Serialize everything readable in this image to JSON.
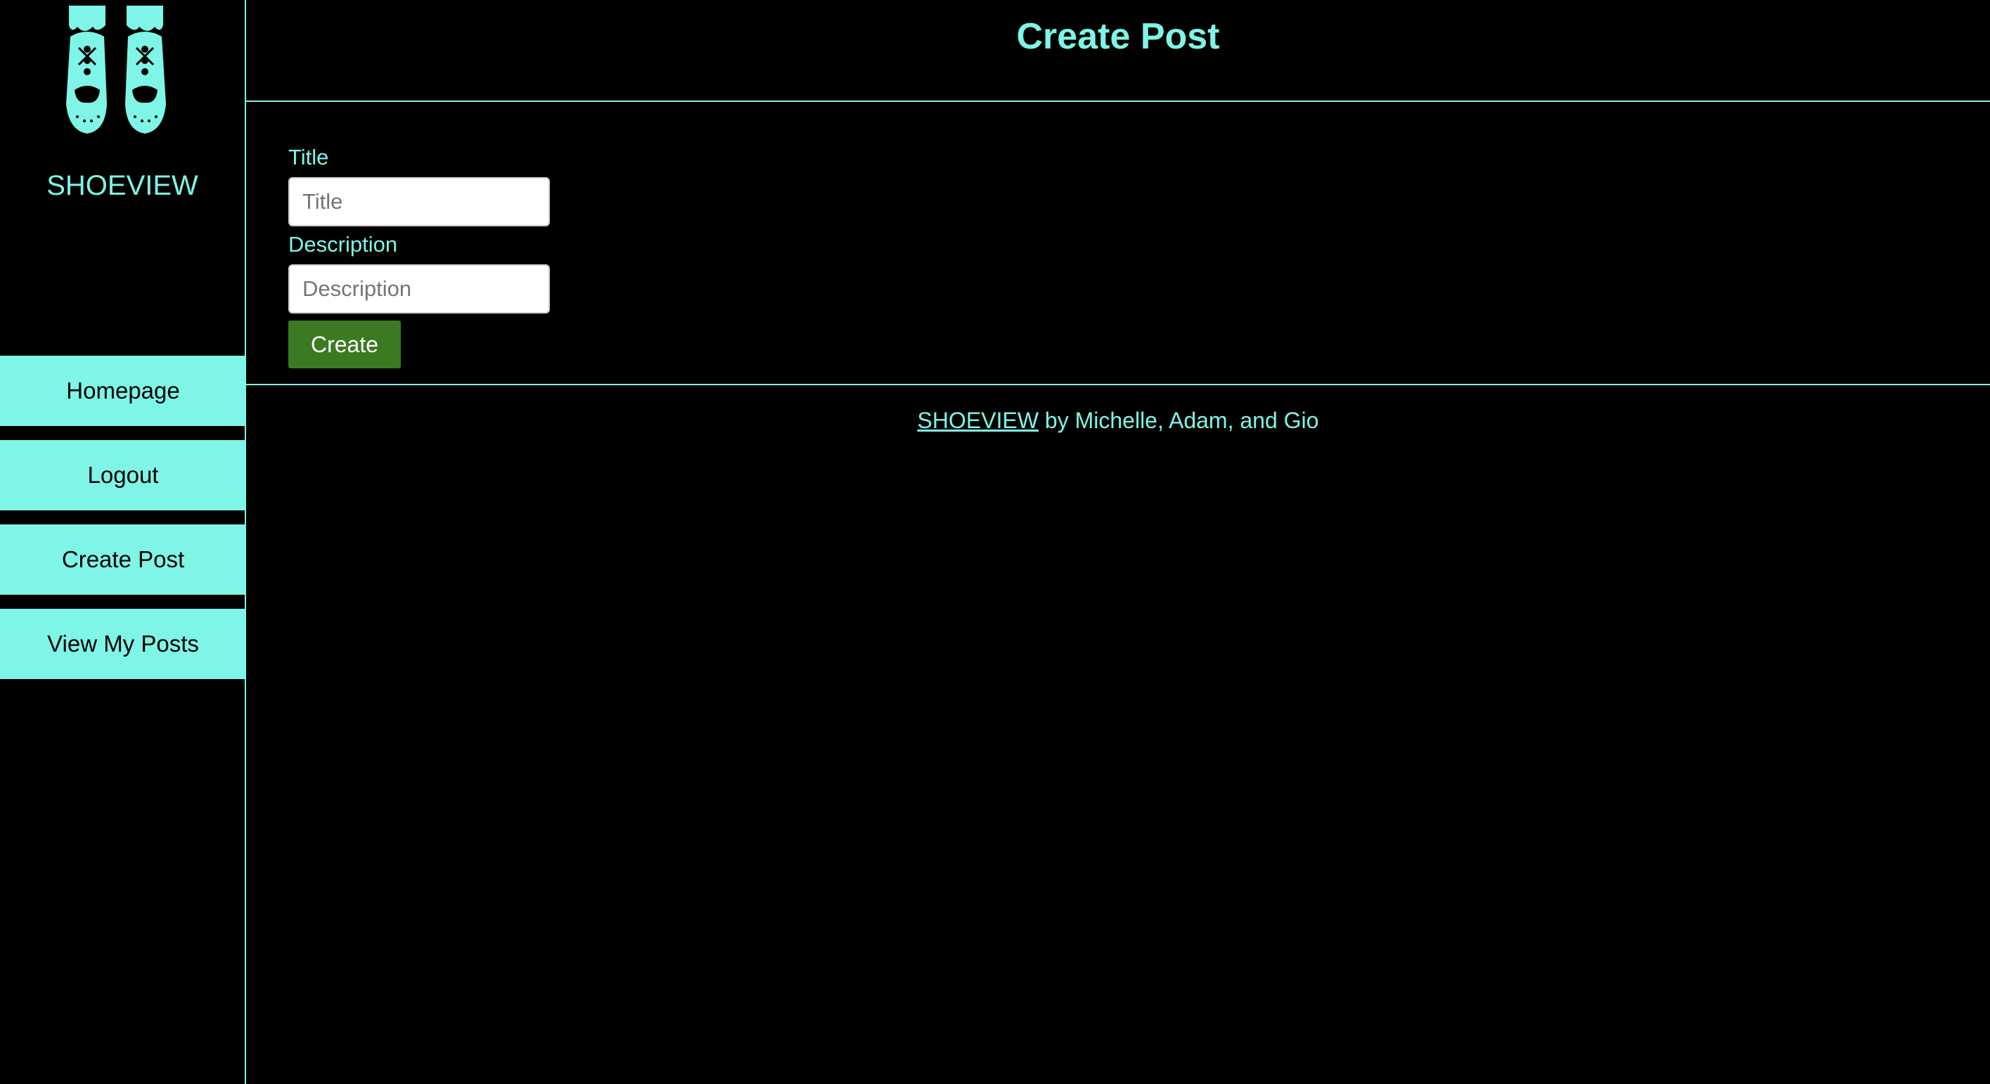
{
  "sidebar": {
    "logo_icon": "shoes-logo-icon",
    "brand": "SHOEVIEW",
    "nav": [
      {
        "label": "Homepage"
      },
      {
        "label": "Logout"
      },
      {
        "label": "Create Post"
      },
      {
        "label": "View My Posts"
      }
    ]
  },
  "main": {
    "title": "Create Post",
    "form": {
      "title_label": "Title",
      "title_placeholder": "Title",
      "title_value": "",
      "description_label": "Description",
      "description_placeholder": "Description",
      "description_value": "",
      "submit_label": "Create"
    }
  },
  "footer": {
    "link_text": "SHOEVIEW",
    "credit": " by Michelle, Adam, and Gio"
  },
  "colors": {
    "background": "#000000",
    "accent": "#7ef5e6",
    "button": "#3b7a22"
  }
}
